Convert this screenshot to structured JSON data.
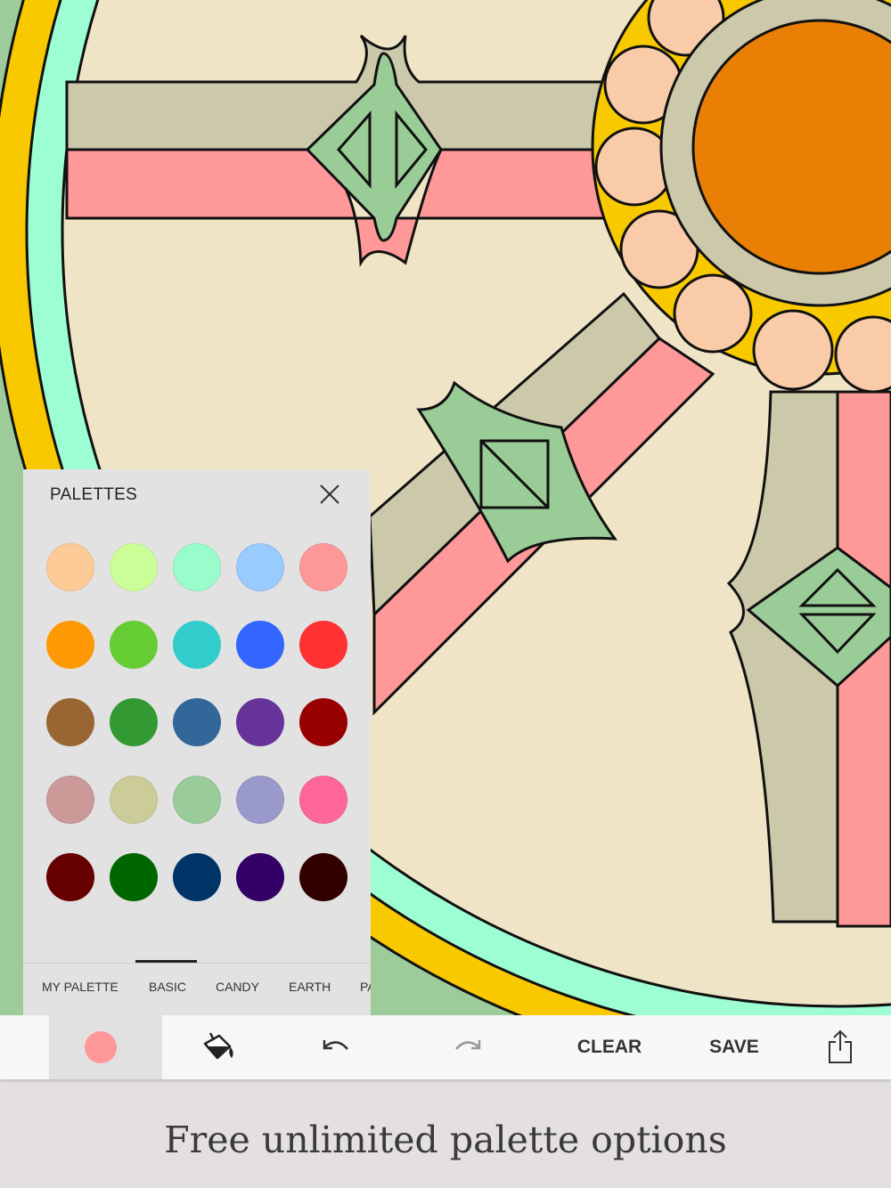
{
  "canvas": {
    "fills": {
      "background": "#9dcc9a",
      "wheel_face": "#efe5c6",
      "outer_ring": "#f9c900",
      "inner_ring": "#9dfed3",
      "spoke_gray": "#ccc9ab",
      "spoke_pink": "#ff9898",
      "joint_green": "#9acc98",
      "hub_ring": "#f9c900",
      "hub_beads": "#f9cba8",
      "hub_gray": "#ccc9ab",
      "hub_center": "#e98005",
      "outline": "#111111"
    }
  },
  "palettes": {
    "title": "PALETTES",
    "close_icon": "close-icon",
    "swatches": [
      [
        "#fccb97",
        "#ccfe98",
        "#98fdcb",
        "#99cbfe",
        "#fe9898"
      ],
      [
        "#fe9904",
        "#66cc33",
        "#33cccc",
        "#3366fe",
        "#fe3232"
      ],
      [
        "#996633",
        "#339933",
        "#336699",
        "#663399",
        "#990000"
      ],
      [
        "#cc9999",
        "#cccc99",
        "#99cc99",
        "#9999cc",
        "#fe6699"
      ],
      [
        "#660000",
        "#006600",
        "#003366",
        "#330066",
        "#330000"
      ]
    ],
    "tabs": [
      "MY PALETTE",
      "BASIC",
      "CANDY",
      "EARTH",
      "PASTEL"
    ],
    "active_tab": "BASIC"
  },
  "toolbar": {
    "current_color": "#fe9898",
    "fill_icon": "paint-bucket-icon",
    "undo_icon": "undo-icon",
    "redo_icon": "redo-icon",
    "clear_label": "CLEAR",
    "save_label": "SAVE",
    "share_icon": "share-icon"
  },
  "tagline": "Free unlimited palette options"
}
